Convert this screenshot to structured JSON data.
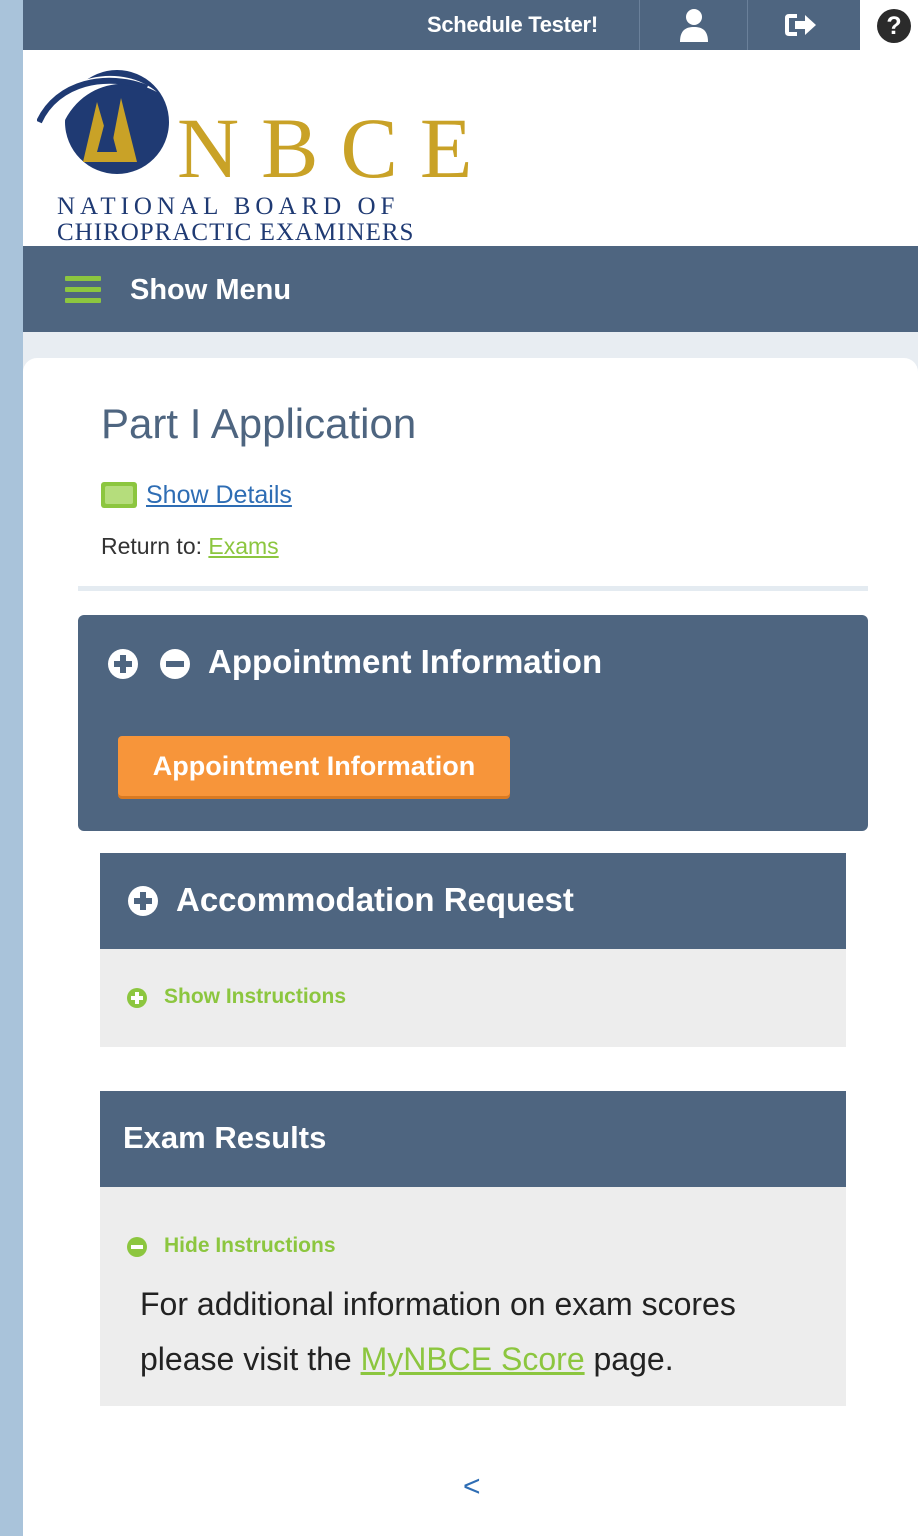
{
  "topbar": {
    "schedule_label": "Schedule Tester!",
    "icons": [
      "user-icon",
      "sign-out-icon",
      "help-icon"
    ],
    "help_glyph": "?"
  },
  "logo": {
    "letters": "NBCE",
    "line1": "NATIONAL BOARD OF",
    "line2": "CHIROPRACTIC EXAMINERS"
  },
  "menu": {
    "label": "Show Menu"
  },
  "page": {
    "title": "Part I Application",
    "show_details": "Show Details",
    "return_prefix": "Return to: ",
    "return_link": "Exams"
  },
  "sections": {
    "appointment": {
      "title": "Appointment Information",
      "button": "Appointment Information"
    },
    "accommodation": {
      "title": "Accommodation Request",
      "instructions_toggle": "Show Instructions"
    },
    "exam_results": {
      "title": "Exam Results",
      "instructions_toggle": "Hide Instructions",
      "text_before": "For additional information on exam scores please visit the ",
      "link": "MyNBCE Score",
      "text_after": " page."
    }
  },
  "pager": {
    "prev": "<"
  },
  "colors": {
    "nav": "#4e6580",
    "accent_green": "#8cc63f",
    "orange": "#f7953a",
    "link_blue": "#2e6db4",
    "gold": "#c9a227",
    "navy_text": "#1f3a73"
  }
}
